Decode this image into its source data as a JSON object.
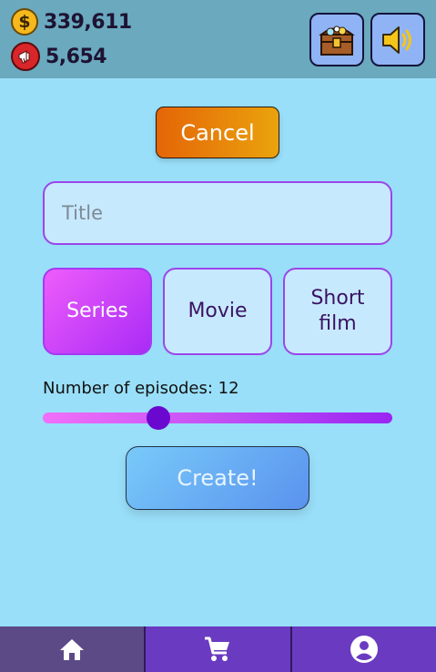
{
  "header": {
    "coins": "339,611",
    "promos": "5,654",
    "coin_symbol": "$"
  },
  "toolbar": {
    "treasure_icon": "treasure-chest-icon",
    "sound_icon": "speaker-icon"
  },
  "form": {
    "cancel_label": "Cancel",
    "title_placeholder": "Title",
    "title_value": "",
    "types": [
      {
        "label": "Series",
        "selected": true
      },
      {
        "label": "Movie",
        "selected": false
      },
      {
        "label": "Short film",
        "selected": false
      }
    ],
    "episodes_label": "Number of episodes: 12",
    "episodes_fraction": 0.33,
    "create_label": "Create!"
  },
  "nav": {
    "items": [
      {
        "icon": "home-icon",
        "active": true
      },
      {
        "icon": "cart-icon",
        "active": false
      },
      {
        "icon": "account-icon",
        "active": false
      }
    ]
  },
  "colors": {
    "background": "#99dff9",
    "topbar": "#6aa9be",
    "accent_purple": "#9b45ea",
    "nav": "#6a3bc1"
  }
}
